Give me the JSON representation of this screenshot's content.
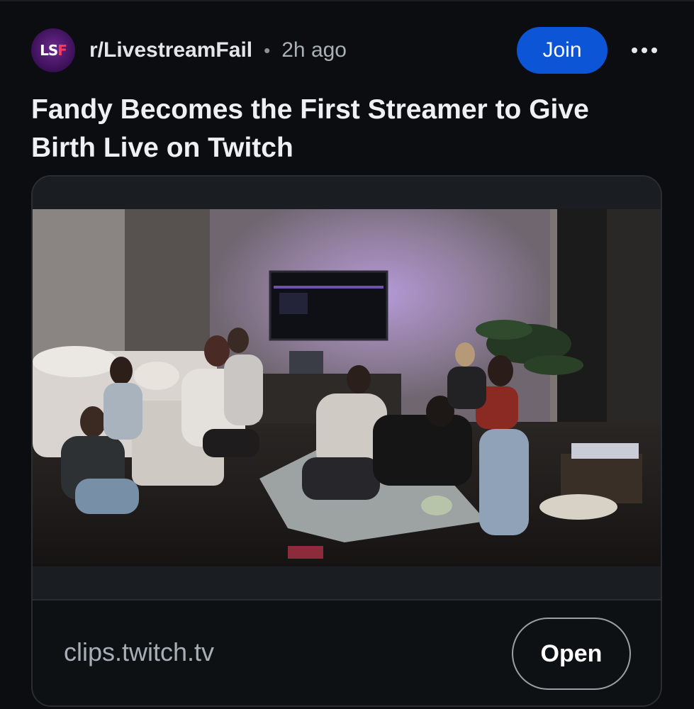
{
  "header": {
    "avatar_alt": "LSF",
    "subreddit": "r/LivestreamFail",
    "separator": "•",
    "time": "2h ago",
    "join_label": "Join",
    "more_icon": "more-horizontal-icon"
  },
  "post": {
    "title": "Fandy Becomes the First Streamer to Give Birth Live on Twitch"
  },
  "link": {
    "domain": "clips.twitch.tv",
    "open_label": "Open"
  },
  "colors": {
    "background": "#0b0d10",
    "join_button": "#0b55d6",
    "avatar": "#3b0f57",
    "avatar_accent": "#ff3b5c"
  }
}
